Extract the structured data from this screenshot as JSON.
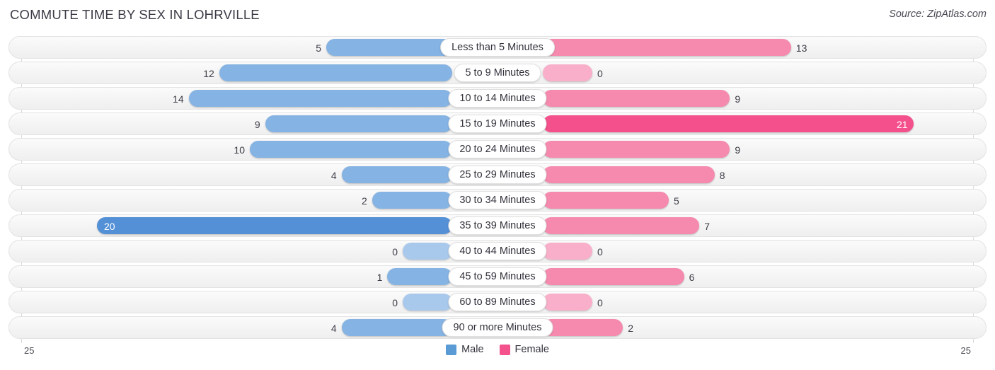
{
  "header": {
    "title": "COMMUTE TIME BY SEX IN LOHRVILLE",
    "source": "Source: ZipAtlas.com"
  },
  "axis": {
    "left_max": "25",
    "right_max": "25"
  },
  "legend": {
    "items": [
      {
        "label": "Male",
        "color": "#5b9bd5"
      },
      {
        "label": "Female",
        "color": "#f4528d"
      }
    ]
  },
  "chart_data": {
    "type": "bar",
    "title": "COMMUTE TIME BY SEX IN LOHRVILLE",
    "subtitle": "Source: ZipAtlas.com",
    "orientation": "horizontal-diverging",
    "xlabel": "",
    "ylabel": "",
    "xlim": [
      25,
      25
    ],
    "grid": true,
    "legend_position": "bottom-center",
    "categories": [
      "Less than 5 Minutes",
      "5 to 9 Minutes",
      "10 to 14 Minutes",
      "15 to 19 Minutes",
      "20 to 24 Minutes",
      "25 to 29 Minutes",
      "30 to 34 Minutes",
      "35 to 39 Minutes",
      "40 to 44 Minutes",
      "45 to 59 Minutes",
      "60 to 89 Minutes",
      "90 or more Minutes"
    ],
    "series": [
      {
        "name": "Male",
        "color": "#85b3e3",
        "peak_color": "#5490d6",
        "values": [
          5,
          12,
          14,
          9,
          10,
          4,
          2,
          20,
          0,
          1,
          0,
          4
        ]
      },
      {
        "name": "Female",
        "color": "#f58aae",
        "peak_color": "#f4508b",
        "values": [
          13,
          0,
          9,
          21,
          9,
          8,
          5,
          7,
          0,
          6,
          0,
          2
        ]
      }
    ]
  }
}
